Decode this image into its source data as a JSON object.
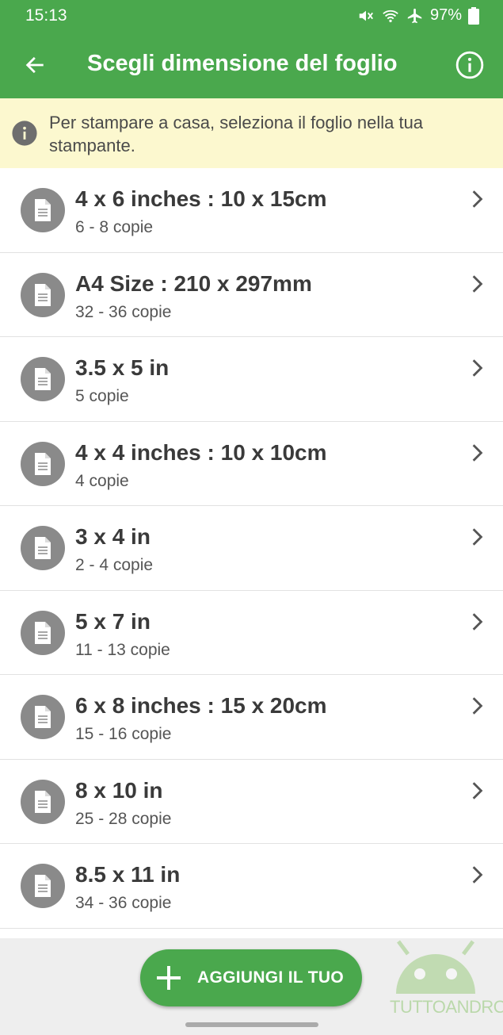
{
  "status_bar": {
    "time": "15:13",
    "battery": "97%"
  },
  "app_bar": {
    "title": "Scegli dimensione del foglio"
  },
  "banner": {
    "text": "Per stampare a casa, seleziona il foglio nella tua stampante."
  },
  "sizes": [
    {
      "title": "4 x 6 inches : 10 x 15cm",
      "subtitle": "6 - 8 copie"
    },
    {
      "title": "A4 Size : 210 x 297mm",
      "subtitle": "32 - 36 copie"
    },
    {
      "title": "3.5 x 5 in",
      "subtitle": "5 copie"
    },
    {
      "title": "4 x 4 inches : 10 x 10cm",
      "subtitle": "4 copie"
    },
    {
      "title": "3 x 4 in",
      "subtitle": "2 - 4 copie"
    },
    {
      "title": "5 x 7 in",
      "subtitle": "11 - 13 copie"
    },
    {
      "title": "6 x 8 inches : 15 x 20cm",
      "subtitle": "15 - 16 copie"
    },
    {
      "title": "8 x 10 in",
      "subtitle": "25 - 28 copie"
    },
    {
      "title": "8.5 x 11 in",
      "subtitle": "34 - 36 copie"
    }
  ],
  "fab": {
    "label": "AGGIUNGI IL TUO"
  },
  "watermark": {
    "text": "TUTTOANDROID"
  },
  "colors": {
    "primary": "#4aa84d",
    "banner_bg": "#fcf8cf",
    "icon_gray": "#8a8a8a"
  }
}
